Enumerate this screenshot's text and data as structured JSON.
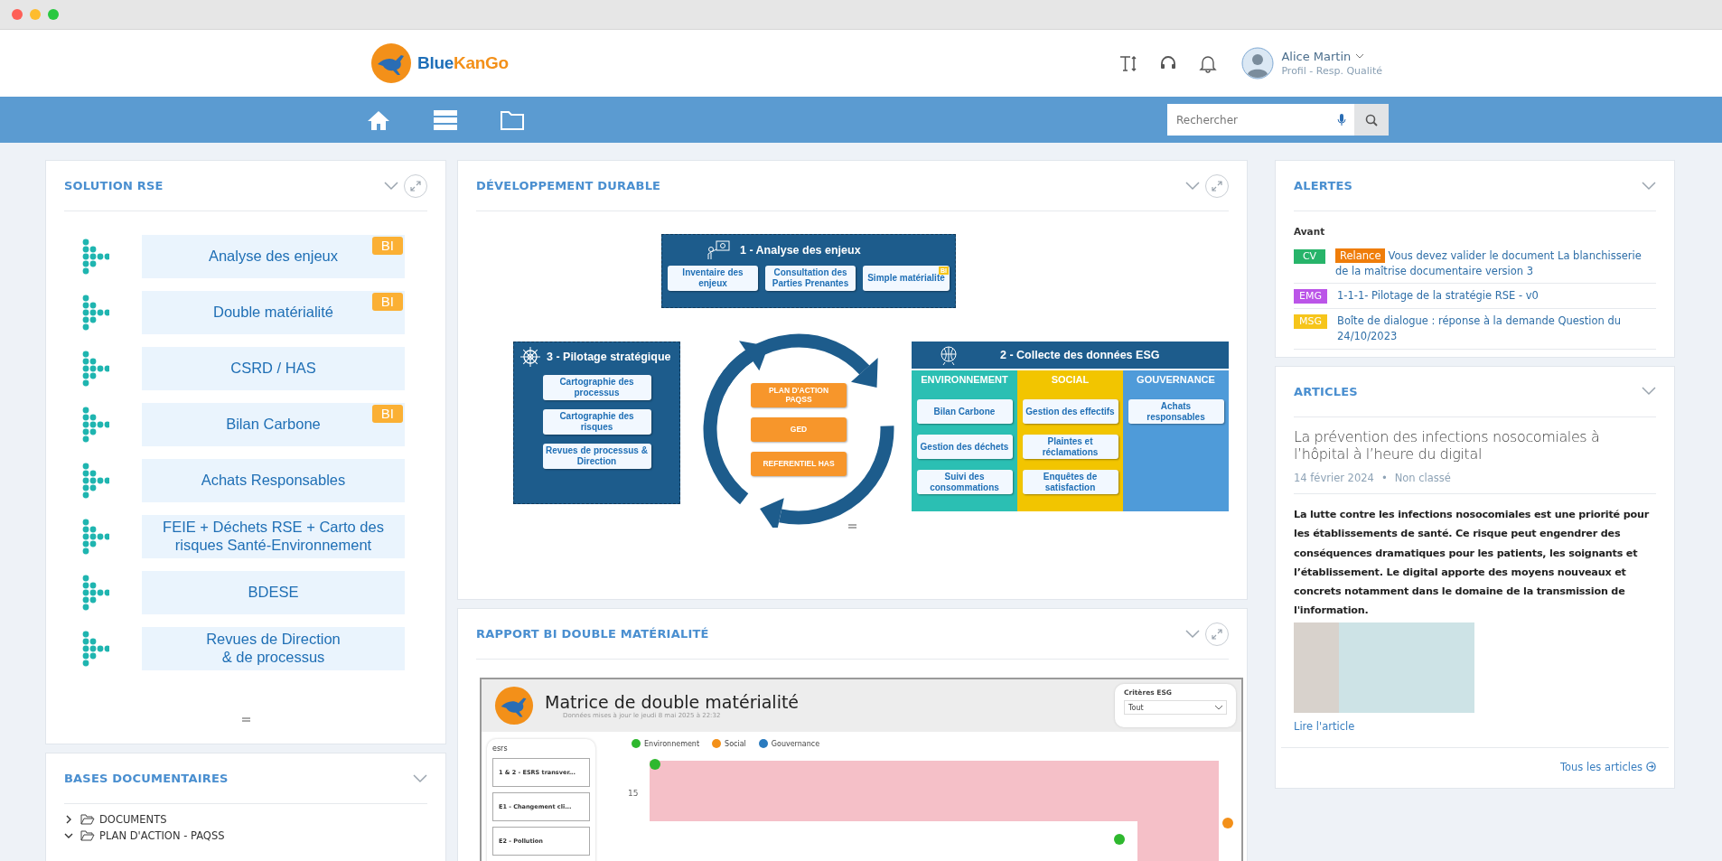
{
  "header": {
    "logo": {
      "part_1": "Blue",
      "part_2": "KanGo"
    },
    "user": {
      "name": "Alice Martin",
      "role": "Profil - Resp. Qualité"
    }
  },
  "nav": {
    "search": {
      "placeholder": "Rechercher"
    }
  },
  "solution_rse": {
    "title": "SOLUTION RSE",
    "expandable": true,
    "items": [
      {
        "label": "Analyse des enjeux",
        "badge": "BI"
      },
      {
        "label": "Double matérialité",
        "badge": "BI"
      },
      {
        "label": "CSRD / HAS"
      },
      {
        "label": "Bilan Carbone",
        "badge": "BI"
      },
      {
        "label": "Achats Responsables"
      },
      {
        "label": "FEIE + Déchets RSE + Carto des risques Santé-Environnement"
      },
      {
        "label": "BDESE"
      },
      {
        "label": "Revues de Direction\n& de processus"
      }
    ]
  },
  "bases_documentaires": {
    "title": "BASES DOCUMENTAIRES",
    "expandable": false,
    "tree": [
      {
        "label": "DOCUMENTS",
        "expanded": false
      },
      {
        "label": "PLAN D'ACTION - PAQSS",
        "expanded": true
      }
    ]
  },
  "developpement_durable": {
    "title": "DÉVELOPPEMENT DURABLE",
    "expandable": true,
    "analyse": {
      "title": "1 - Analyse des enjeux",
      "items": [
        {
          "label": "Inventaire des enjeux"
        },
        {
          "label": "Consultation des Parties Prenantes"
        },
        {
          "label": "Simple matérialité",
          "badge": "BI"
        }
      ]
    },
    "pilotage": {
      "title": "3 - Pilotage stratégique",
      "items": [
        {
          "label": "Cartographie des processus"
        },
        {
          "label": "Cartographie des risques"
        },
        {
          "label": "Revues de processus & Direction"
        }
      ]
    },
    "centre": [
      {
        "label": "PLAN D'ACTION PAQSS"
      },
      {
        "label": "GED"
      },
      {
        "label": "REFERENTIEL HAS"
      }
    ],
    "collecte": {
      "title": "2 - Collecte des données ESG",
      "columns": [
        {
          "title": "ENVIRONNEMENT",
          "color": "#2bbfb3",
          "items": [
            "Bilan Carbone",
            "Gestion des déchets",
            "Suivi des consommations"
          ]
        },
        {
          "title": "SOCIAL",
          "color": "#f2c500",
          "items": [
            "Gestion des effectifs",
            "Plaintes et réclamations",
            "Enquêtes de satisfaction"
          ]
        },
        {
          "title": "GOUVERNANCE",
          "color": "#4f9bd9",
          "items": [
            "Achats responsables"
          ]
        }
      ]
    }
  },
  "rapport_bi": {
    "title": "RAPPORT BI DOUBLE MATÉRIALITÉ",
    "expandable": true,
    "report": {
      "title": "Matrice de double matérialité",
      "updated": "Données mises à jour le jeudi 8 mai 2025 à 22:32",
      "filter": {
        "label": "Critères ESG",
        "value": "Tout"
      },
      "list_title": "esrs",
      "list": [
        "1 & 2 - ESRS transver...",
        "E1 - Changement cli...",
        "E2 - Pollution"
      ],
      "legend": [
        {
          "label": "Environnement",
          "color": "#2eb82e"
        },
        {
          "label": "Social",
          "color": "#f39019"
        },
        {
          "label": "Gouvernance",
          "color": "#2a7bbf"
        }
      ],
      "y_tick": "15"
    }
  },
  "alertes": {
    "title": "ALERTES",
    "expandable": false,
    "group": "Avant",
    "items": [
      {
        "tag": {
          "text": "CV",
          "color": "#27b46a"
        },
        "flag": {
          "text": "Relance",
          "color": "#ef7d0a"
        },
        "text": "Vous devez valider le document La blanchisserie de la maîtrise documentaire version 3"
      },
      {
        "tag": {
          "text": "EMG",
          "color": "#bb55e8"
        },
        "text": "1-1-1- Pilotage de la stratégie RSE - v0"
      },
      {
        "tag": {
          "text": "MSG",
          "color": "#f6c51b"
        },
        "text": "Boîte de dialogue : réponse à la demande Question du 24/10/2023"
      }
    ]
  },
  "articles": {
    "title": "ARTICLES",
    "expandable": false,
    "article": {
      "title": "La prévention des infections nosocomiales à l’hôpital à l’heure du digital",
      "date": "14 février 2024",
      "separator": "•",
      "category": "Non classé",
      "body": "La lutte contre les infections nosocomiales est une priorité pour les établissements de santé. Ce risque peut engendrer des conséquences dramatiques pour les patients, les soignants et l’établissement. Le digital apporte des moyens nouveaux et concrets notamment dans le domaine de la transmission de l'information.",
      "link": "Lire l'article"
    },
    "all_link": "Tous les articles"
  }
}
